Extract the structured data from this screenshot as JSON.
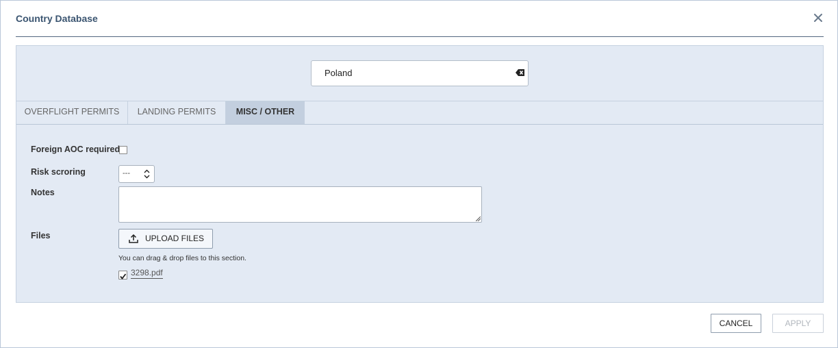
{
  "dialog": {
    "title": "Country Database"
  },
  "search": {
    "value": "Poland"
  },
  "tabs": [
    {
      "label": "OVERFLIGHT PERMITS",
      "active": false
    },
    {
      "label": "LANDING PERMITS",
      "active": false
    },
    {
      "label": "MISC / OTHER",
      "active": true
    }
  ],
  "form": {
    "foreign_aoc_label": "Foreign AOC required",
    "foreign_aoc_checked": false,
    "risk_label": "Risk scroring",
    "risk_value": "---",
    "notes_label": "Notes",
    "notes_value": "",
    "files_label": "Files",
    "upload_label": "UPLOAD FILES",
    "drop_hint": "You can drag & drop files to this section.",
    "files": [
      {
        "name": "3298.pdf",
        "checked": true
      }
    ]
  },
  "footer": {
    "cancel_label": "CANCEL",
    "apply_label": "APPLY"
  },
  "colors": {
    "title": "#3a5470",
    "panel_bg": "#e3eaf4",
    "active_tab_bg": "#c3cfdf"
  },
  "icons": {
    "close": "close-icon",
    "clear": "backspace-clear-icon",
    "upload": "upload-icon",
    "select": "updown-arrows-icon"
  }
}
